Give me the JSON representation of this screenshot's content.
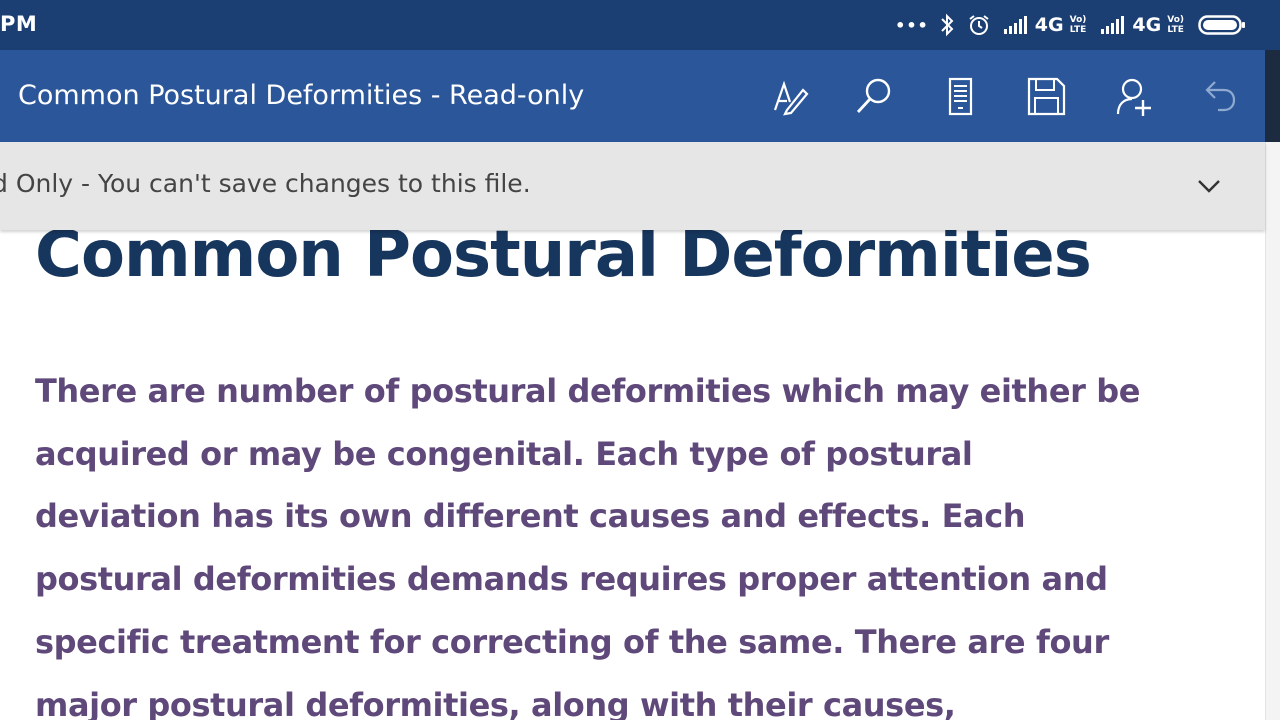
{
  "status_bar": {
    "time": "PM",
    "more": "•••",
    "network_1": "4G",
    "network_2": "4G",
    "volte_1_top": "Vo)",
    "volte_1_bottom": "LTE",
    "volte_2_top": "Vo)",
    "volte_2_bottom": "LTE",
    "icons": [
      "bluetooth-icon",
      "alarm-icon",
      "signal-icon",
      "signal-icon",
      "battery-icon"
    ]
  },
  "app_bar": {
    "title": "Common Postural Deformities - Read-only",
    "tools": [
      "draw-icon",
      "search-icon",
      "mobile-view-icon",
      "save-icon",
      "share-person-icon",
      "undo-icon"
    ]
  },
  "banner": {
    "text": "d Only - You can't save changes to this file.",
    "chevron": "chevron-down-icon"
  },
  "document": {
    "heading": "Common Postural Deformities",
    "paragraph_lines": [
      "There are number of postural deformities which may either be",
      "acquired or may be congenital. Each type of postural",
      "deviation has its own different causes and effects. Each",
      "postural deformities demands requires proper attention and",
      "specific treatment for correcting of the same. There are four",
      "major postural deformities, along with their causes,"
    ]
  },
  "colors": {
    "status_bar": "#1b3f72",
    "app_bar": "#2b579a",
    "banner": "#e6e6e6",
    "heading": "#17365d",
    "body_text": "#5f497a"
  }
}
